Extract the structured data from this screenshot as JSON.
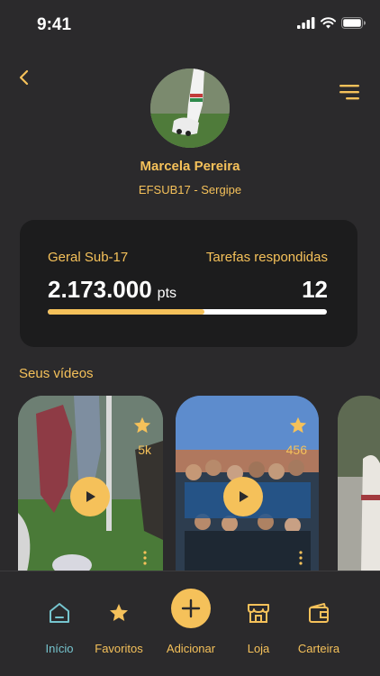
{
  "status_bar": {
    "time": "9:41"
  },
  "header": {
    "back_icon": "chevron-left-icon",
    "menu_icon": "hamburger-menu-icon"
  },
  "profile": {
    "name": "Marcela Pereira",
    "team": "EFSUB17 - Sergipe"
  },
  "stats": {
    "ranking_label": "Geral Sub-17",
    "tasks_label": "Tarefas respondidas",
    "points_value": "2.173.000",
    "points_unit": "pts",
    "tasks_value": "12",
    "progress_fraction": 0.56
  },
  "videos": {
    "section_title": "Seus vídeos",
    "items": [
      {
        "count": "5k"
      },
      {
        "count": "456"
      },
      {
        "count": ""
      }
    ]
  },
  "bottom_nav": {
    "items": [
      {
        "label": "Início",
        "icon": "home-icon",
        "active": true
      },
      {
        "label": "Favoritos",
        "icon": "star-icon",
        "active": false
      },
      {
        "label": "Adicionar",
        "icon": "plus-icon",
        "active": false
      },
      {
        "label": "Loja",
        "icon": "store-icon",
        "active": false
      },
      {
        "label": "Carteira",
        "icon": "wallet-icon",
        "active": false
      }
    ]
  },
  "colors": {
    "accent": "#f5c15a",
    "active_nav": "#76c5cf",
    "background": "#2b2a2c",
    "card": "#1c1c1d"
  }
}
